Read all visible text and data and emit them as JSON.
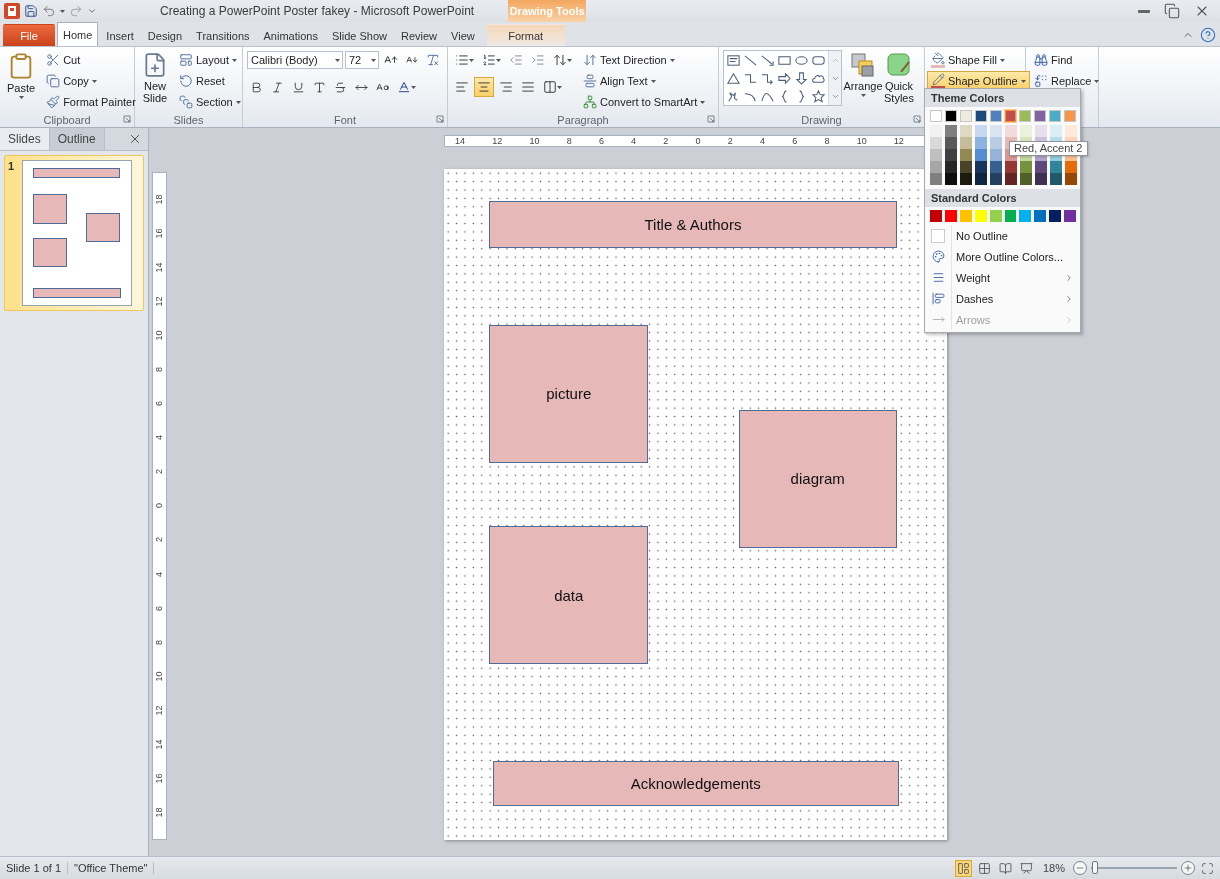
{
  "window": {
    "title": "Creating a PowerPoint Poster fakey  -  Microsoft PowerPoint",
    "contextual_header": "Drawing Tools"
  },
  "tabs": [
    {
      "label": "File",
      "kind": "file",
      "selected": false
    },
    {
      "label": "Home",
      "kind": "normal",
      "selected": true
    },
    {
      "label": "Insert",
      "kind": "normal",
      "selected": false
    },
    {
      "label": "Design",
      "kind": "normal",
      "selected": false
    },
    {
      "label": "Transitions",
      "kind": "normal",
      "selected": false
    },
    {
      "label": "Animations",
      "kind": "normal",
      "selected": false
    },
    {
      "label": "Slide Show",
      "kind": "normal",
      "selected": false
    },
    {
      "label": "Review",
      "kind": "normal",
      "selected": false
    },
    {
      "label": "View",
      "kind": "normal",
      "selected": false
    },
    {
      "label": "Format",
      "kind": "contextual",
      "selected": false
    }
  ],
  "ribbon": {
    "clipboard": {
      "label": "Clipboard",
      "paste": "Paste",
      "items": [
        "Cut",
        "Copy",
        "Format Painter"
      ]
    },
    "slides": {
      "label": "Slides",
      "new_slide": "New Slide",
      "items": [
        "Layout",
        "Reset",
        "Section"
      ]
    },
    "font": {
      "label": "Font",
      "font_name": "Calibri (Body)",
      "font_size": "72"
    },
    "paragraph": {
      "label": "Paragraph",
      "alignments": [
        {
          "selected": false
        },
        {
          "selected": true
        },
        {
          "selected": false
        },
        {
          "selected": false
        }
      ],
      "items": [
        "Text Direction",
        "Align Text",
        "Convert to SmartArt"
      ]
    },
    "drawing": {
      "label": "Drawing",
      "arrange": "Arrange",
      "quick_styles": "Quick Styles",
      "shape_fill": "Shape Fill",
      "shape_outline": {
        "label": "Shape Outline",
        "expanded": true
      }
    },
    "editing": {
      "items": [
        "Find",
        "Replace"
      ]
    }
  },
  "slide_panel": {
    "tabs": [
      {
        "label": "Slides",
        "selected": true
      },
      {
        "label": "Outline",
        "selected": false
      }
    ],
    "thumbnails": [
      {
        "number": "1",
        "selected": true
      }
    ]
  },
  "rulers": {
    "horizontal": [
      "14",
      "12",
      "10",
      "8",
      "6",
      "4",
      "2",
      "0",
      "2",
      "4",
      "6",
      "8",
      "10",
      "12"
    ],
    "vertical": [
      "18",
      "16",
      "14",
      "12",
      "10",
      "8",
      "6",
      "4",
      "2",
      "0",
      "2",
      "4",
      "6",
      "8",
      "10",
      "12",
      "14",
      "16",
      "18"
    ]
  },
  "slide": {
    "shapes": [
      {
        "text": "Title & Authors"
      },
      {
        "text": "picture"
      },
      {
        "text": "diagram"
      },
      {
        "text": "data"
      },
      {
        "text": "Acknowledgements"
      }
    ]
  },
  "outline_menu": {
    "theme_header": "Theme Colors",
    "standard_header": "Standard Colors",
    "theme_colors": [
      {
        "color": "#ffffff",
        "selected": false,
        "shades": [
          {
            "color": "#f2f2f2"
          },
          {
            "color": "#d9d9d9"
          },
          {
            "color": "#bfbfbf"
          },
          {
            "color": "#a6a6a6"
          },
          {
            "color": "#808080"
          }
        ]
      },
      {
        "color": "#000000",
        "selected": false,
        "shades": [
          {
            "color": "#7f7f7f"
          },
          {
            "color": "#595959"
          },
          {
            "color": "#404040"
          },
          {
            "color": "#262626"
          },
          {
            "color": "#0d0d0d"
          }
        ]
      },
      {
        "color": "#eeece1",
        "selected": false,
        "shades": [
          {
            "color": "#ddd9c3"
          },
          {
            "color": "#c4bd97"
          },
          {
            "color": "#938953"
          },
          {
            "color": "#494429"
          },
          {
            "color": "#1d1b10"
          }
        ]
      },
      {
        "color": "#1f497d",
        "selected": false,
        "shades": [
          {
            "color": "#c6d9f0"
          },
          {
            "color": "#8db3e2"
          },
          {
            "color": "#548dd4"
          },
          {
            "color": "#17365d"
          },
          {
            "color": "#0f243e"
          }
        ]
      },
      {
        "color": "#4f81bd",
        "selected": false,
        "shades": [
          {
            "color": "#dbe5f1"
          },
          {
            "color": "#b8cce4"
          },
          {
            "color": "#95b3d7"
          },
          {
            "color": "#366092"
          },
          {
            "color": "#244061"
          }
        ]
      },
      {
        "color": "#c0504d",
        "selected": true,
        "shades": [
          {
            "color": "#f2dcdb"
          },
          {
            "color": "#e5b9b7"
          },
          {
            "color": "#d99694"
          },
          {
            "color": "#953734"
          },
          {
            "color": "#632423"
          }
        ]
      },
      {
        "color": "#9bbb59",
        "selected": false,
        "shades": [
          {
            "color": "#ebf1dd"
          },
          {
            "color": "#d7e3bc"
          },
          {
            "color": "#c3d69b"
          },
          {
            "color": "#76923c"
          },
          {
            "color": "#4f6128"
          }
        ]
      },
      {
        "color": "#8064a2",
        "selected": false,
        "shades": [
          {
            "color": "#e5e0ec"
          },
          {
            "color": "#ccc1d9"
          },
          {
            "color": "#b2a2c7"
          },
          {
            "color": "#5f497a"
          },
          {
            "color": "#3f3151"
          }
        ]
      },
      {
        "color": "#4bacc6",
        "selected": false,
        "shades": [
          {
            "color": "#dbeef3"
          },
          {
            "color": "#b7dde8"
          },
          {
            "color": "#92cddc"
          },
          {
            "color": "#31859b"
          },
          {
            "color": "#205867"
          }
        ]
      },
      {
        "color": "#f79646",
        "selected": false,
        "shades": [
          {
            "color": "#fdeada"
          },
          {
            "color": "#fbd5b5"
          },
          {
            "color": "#fac08f"
          },
          {
            "color": "#e36c09"
          },
          {
            "color": "#974806"
          }
        ]
      }
    ],
    "standard_colors": [
      {
        "color": "#c00000"
      },
      {
        "color": "#ff0000"
      },
      {
        "color": "#ffc000"
      },
      {
        "color": "#ffff00"
      },
      {
        "color": "#92d050"
      },
      {
        "color": "#00b050"
      },
      {
        "color": "#00b0f0"
      },
      {
        "color": "#0070c0"
      },
      {
        "color": "#002060"
      },
      {
        "color": "#7030a0"
      }
    ],
    "items": [
      {
        "label": "No Outline",
        "kind": "plain",
        "disabled": false
      },
      {
        "label": "More Outline Colors...",
        "kind": "plain",
        "disabled": false
      },
      {
        "label": "Weight",
        "kind": "submenu",
        "disabled": false
      },
      {
        "label": "Dashes",
        "kind": "submenu",
        "disabled": false
      },
      {
        "label": "Arrows",
        "kind": "submenu",
        "disabled": true
      }
    ]
  },
  "tooltip": "Red, Accent 2",
  "status_bar": {
    "slide": "Slide 1 of 1",
    "theme": "\"Office Theme\"",
    "views": [
      {
        "selected": true
      },
      {
        "selected": false
      },
      {
        "selected": false
      },
      {
        "selected": false
      }
    ],
    "zoom": "18%",
    "zoom_slider": {
      "level": 0.05
    }
  }
}
